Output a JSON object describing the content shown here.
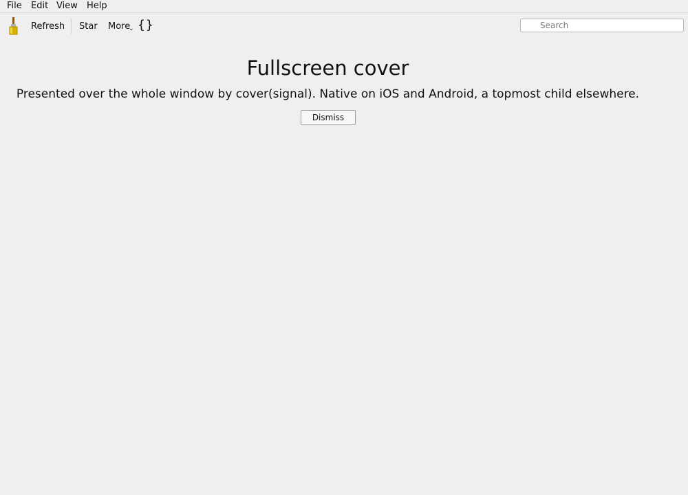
{
  "menubar": {
    "items": [
      "File",
      "Edit",
      "View",
      "Help"
    ]
  },
  "toolbar": {
    "app_icon": "paintbrush-icon",
    "refresh_label": "Refresh",
    "star_label": "Star",
    "more_label": "More",
    "more_chevron": "⌄",
    "braces_icon": "braces-icon",
    "braces_glyph": "{}"
  },
  "search": {
    "placeholder": "Search",
    "value": ""
  },
  "cover": {
    "title": "Fullscreen cover",
    "description": "Presented over the whole window by cover(signal). Native on iOS and Android, a topmost child elsewhere.",
    "dismiss_label": "Dismiss"
  },
  "colors": {
    "background": "#efefef",
    "brush_handle": "#c8a000",
    "brush_ferrule": "#b0b0b0",
    "brush_bristles": "#8a5a1a"
  }
}
